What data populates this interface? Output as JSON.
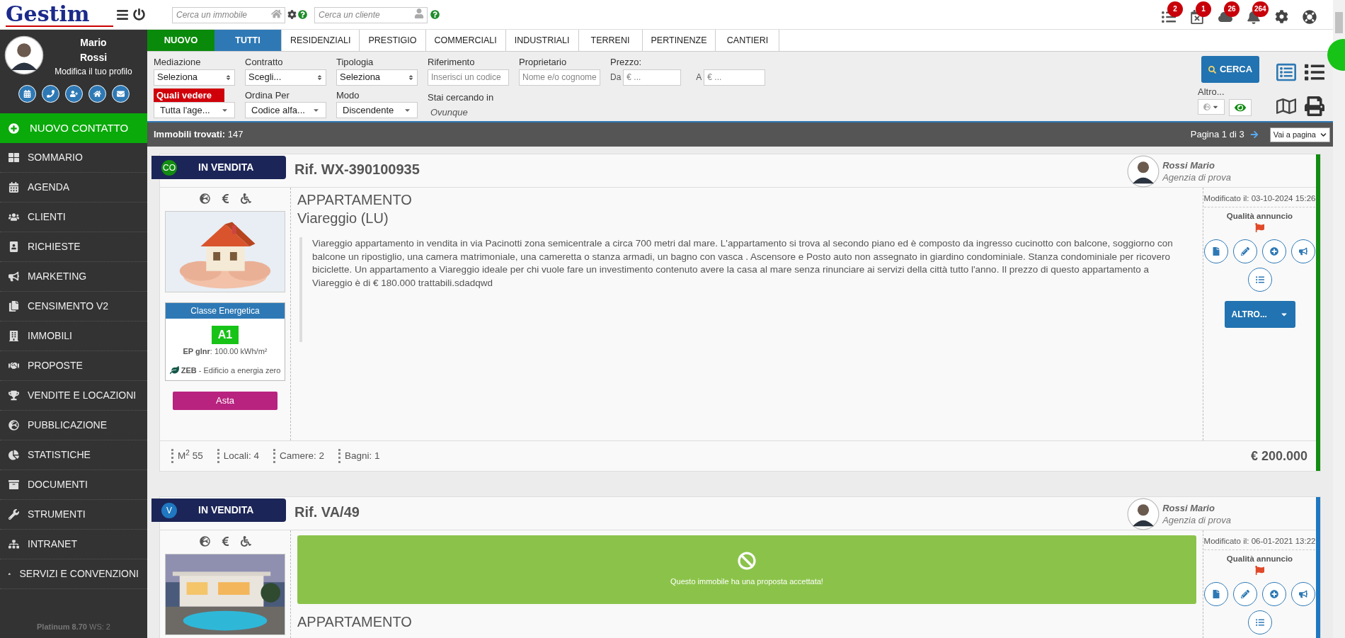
{
  "logo": "Gestim",
  "header": {
    "search_property": {
      "placeholder": "Cerca un immobile"
    },
    "search_client": {
      "placeholder": "Cerca un cliente"
    },
    "notifications": [
      {
        "count": "2"
      },
      {
        "count": "1"
      },
      {
        "count": "26"
      },
      {
        "count": "264"
      }
    ]
  },
  "user": {
    "first_name": "Mario",
    "last_name": "Rossi",
    "profile_link": "Modifica il tuo profilo"
  },
  "sidebar": {
    "new_contact": "NUOVO CONTATTO",
    "items": [
      {
        "label": "SOMMARIO",
        "selected": false
      },
      {
        "label": "AGENDA",
        "selected": false
      },
      {
        "label": "CLIENTI",
        "selected": false
      },
      {
        "label": "RICHIESTE",
        "selected": false
      },
      {
        "label": "MARKETING",
        "selected": false
      },
      {
        "label": "CENSIMENTO V2",
        "selected": false
      },
      {
        "label": "IMMOBILI",
        "selected": false
      },
      {
        "label": "PROPOSTE",
        "selected": false
      },
      {
        "label": "VENDITE E LOCAZIONI",
        "selected": false
      },
      {
        "label": "PUBBLICAZIONE",
        "selected": false
      },
      {
        "label": "STATISTICHE",
        "selected": false
      },
      {
        "label": "DOCUMENTI",
        "selected": false
      },
      {
        "label": "STRUMENTI",
        "selected": false
      },
      {
        "label": "INTRANET",
        "selected": false
      },
      {
        "label": "SERVIZI E CONVENZIONI",
        "selected": false
      }
    ],
    "version": "Platinum 8.70",
    "ws": "WS: 2"
  },
  "new_button": "NUOVO",
  "tabs": [
    {
      "label": "TUTTI",
      "selected": true
    },
    {
      "label": "RESIDENZIALI",
      "selected": false
    },
    {
      "label": "PRESTIGIO",
      "selected": false
    },
    {
      "label": "COMMERCIALI",
      "selected": false
    },
    {
      "label": "INDUSTRIALI",
      "selected": false
    },
    {
      "label": "TERRENI",
      "selected": false
    },
    {
      "label": "PERTINENZE",
      "selected": false
    },
    {
      "label": "CANTIERI",
      "selected": false
    }
  ],
  "filters": {
    "row1": [
      {
        "kind": "select",
        "label": "Mediazione",
        "value": "Seleziona"
      },
      {
        "kind": "select",
        "label": "Contratto",
        "value": "Scegli..."
      },
      {
        "kind": "select",
        "label": "Tipologia",
        "value": "Seleziona"
      },
      {
        "kind": "input",
        "label": "Riferimento",
        "placeholder": "Inserisci un codice"
      },
      {
        "kind": "input",
        "label": "Proprietario",
        "placeholder": "Nome e/o cognome"
      }
    ],
    "price": {
      "label": "Prezzo:",
      "from_label": "Da",
      "from_placeholder": "€ ...",
      "to_label": "A",
      "to_placeholder": "€ ..."
    },
    "row2": [
      {
        "kind": "dropdown",
        "label": "Quali vedere",
        "highlight": true,
        "value": "Tutta l'age..."
      },
      {
        "kind": "dropdown",
        "label": "Ordina Per",
        "highlight": false,
        "value": "Codice alfa..."
      },
      {
        "kind": "dropdown",
        "label": "Modo",
        "highlight": false,
        "value": "Discendente"
      },
      {
        "kind": "text",
        "label": "Stai cercando in",
        "value": "Ovunque"
      }
    ],
    "search_button": "CERCA",
    "more_label": "Altro..."
  },
  "results": {
    "label": "Immobili trovati:",
    "count": "147",
    "page": "Pagina 1 di 3",
    "goto": "Vai a pagina"
  },
  "listings": [
    {
      "badge": "CO",
      "color": "#128c12",
      "status": "IN VENDITA",
      "ref": "Rif. WX-390100935",
      "agent": "Rossi Mario",
      "agency": "Agenzia di prova",
      "type": "APPARTAMENTO",
      "city": "Viareggio (LU)",
      "description": "Viareggio appartamento in vendita in via Pacinotti zona semicentrale a circa 700 metri dal mare. L'appartamento si trova al secondo piano ed è composto da ingresso cucinotto con balcone, soggiorno con balcone un ripostiglio, una camera matrimoniale, una cameretta o stanza armadi, un bagno con vasca . Ascensore e Posto auto non assegnato in giardino condominiale. Stanza condominiale per ricovero biciclette. Un appartamento a Viareggio ideale per chi vuole fare un investimento contenuto avere la casa al mare senza rinunciare ai servizi della città tutto l'anno. Il prezzo di questo appartamento a Viareggio è di € 180.000 trattabili.sdadqwd",
      "energy": {
        "title": "Classe Energetica",
        "class": "A1",
        "ep_label": "EP glnr",
        "ep_value": ": 100.00 kWh/m²",
        "zeb_label": "ZEB",
        "zeb_text": " - Edificio a energia zero"
      },
      "auction": "Asta",
      "features": [
        "M$^{2}$ 55",
        "Locali: 4",
        "Camere: 2",
        "Bagni: 1"
      ],
      "price": "€ 200.000",
      "modified": "Modificato il: 03-10-2024 15:26",
      "quality_label": "Qualità annuncio",
      "more_button": "ALTRO..."
    },
    {
      "badge": "V",
      "color": "#1f78c1",
      "status": "IN VENDITA",
      "ref": "Rif. VA/49",
      "agent": "Rossi Mario",
      "agency": "Agenzia di prova",
      "type": "APPARTAMENTO",
      "notice": "Questo immobile ha una proposta accettata!",
      "modified": "Modificato il: 06-01-2021 13:22",
      "quality_label": "Qualità annuncio"
    }
  ]
}
